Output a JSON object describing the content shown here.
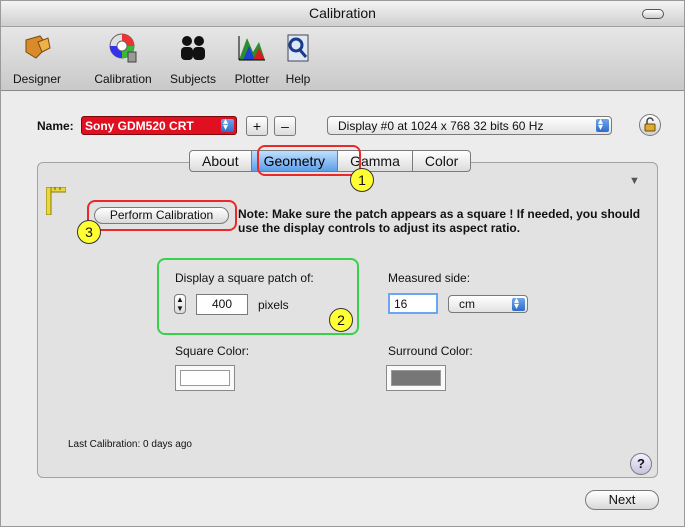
{
  "window": {
    "title": "Calibration"
  },
  "toolbar": {
    "items": [
      {
        "label": "Designer",
        "icon": "designer-icon"
      },
      {
        "label": "Calibration",
        "icon": "calibration-icon"
      },
      {
        "label": "Subjects",
        "icon": "subjects-icon"
      },
      {
        "label": "Plotter",
        "icon": "plotter-icon"
      },
      {
        "label": "Help",
        "icon": "help-icon"
      }
    ]
  },
  "name_row": {
    "label": "Name:",
    "value": "Sony GDM520 CRT",
    "plus": "+",
    "minus": "–",
    "display": "Display #0 at 1024 x 768  32 bits  60 Hz"
  },
  "tabs": [
    {
      "label": "About"
    },
    {
      "label": "Geometry"
    },
    {
      "label": "Gamma"
    },
    {
      "label": "Color"
    }
  ],
  "geometry": {
    "perform_button": "Perform Calibration",
    "note": "Note: Make sure the patch appears as a square ! If needed, you should use the display controls to adjust its aspect ratio.",
    "square_patch_label": "Display a square patch of:",
    "square_patch_value": "400",
    "square_patch_unit": "pixels",
    "measured_side_label": "Measured side:",
    "measured_side_value": "16",
    "measured_side_unit": "cm",
    "square_color_label": "Square Color:",
    "surround_color_label": "Surround Color:",
    "last_calibration": "Last Calibration: 0 days ago"
  },
  "annotations": {
    "badge1": "1",
    "badge2": "2",
    "badge3": "3"
  },
  "help_button": "?",
  "next_button": "Next",
  "colors": {
    "name_select_bg": "#e01020",
    "active_tab": "#5d9ee8",
    "highlight_red": "#ea2a2a",
    "highlight_green": "#39d14a",
    "badge_yellow": "#ffff33",
    "square_color": "#ffffff",
    "surround_color": "#777777"
  }
}
